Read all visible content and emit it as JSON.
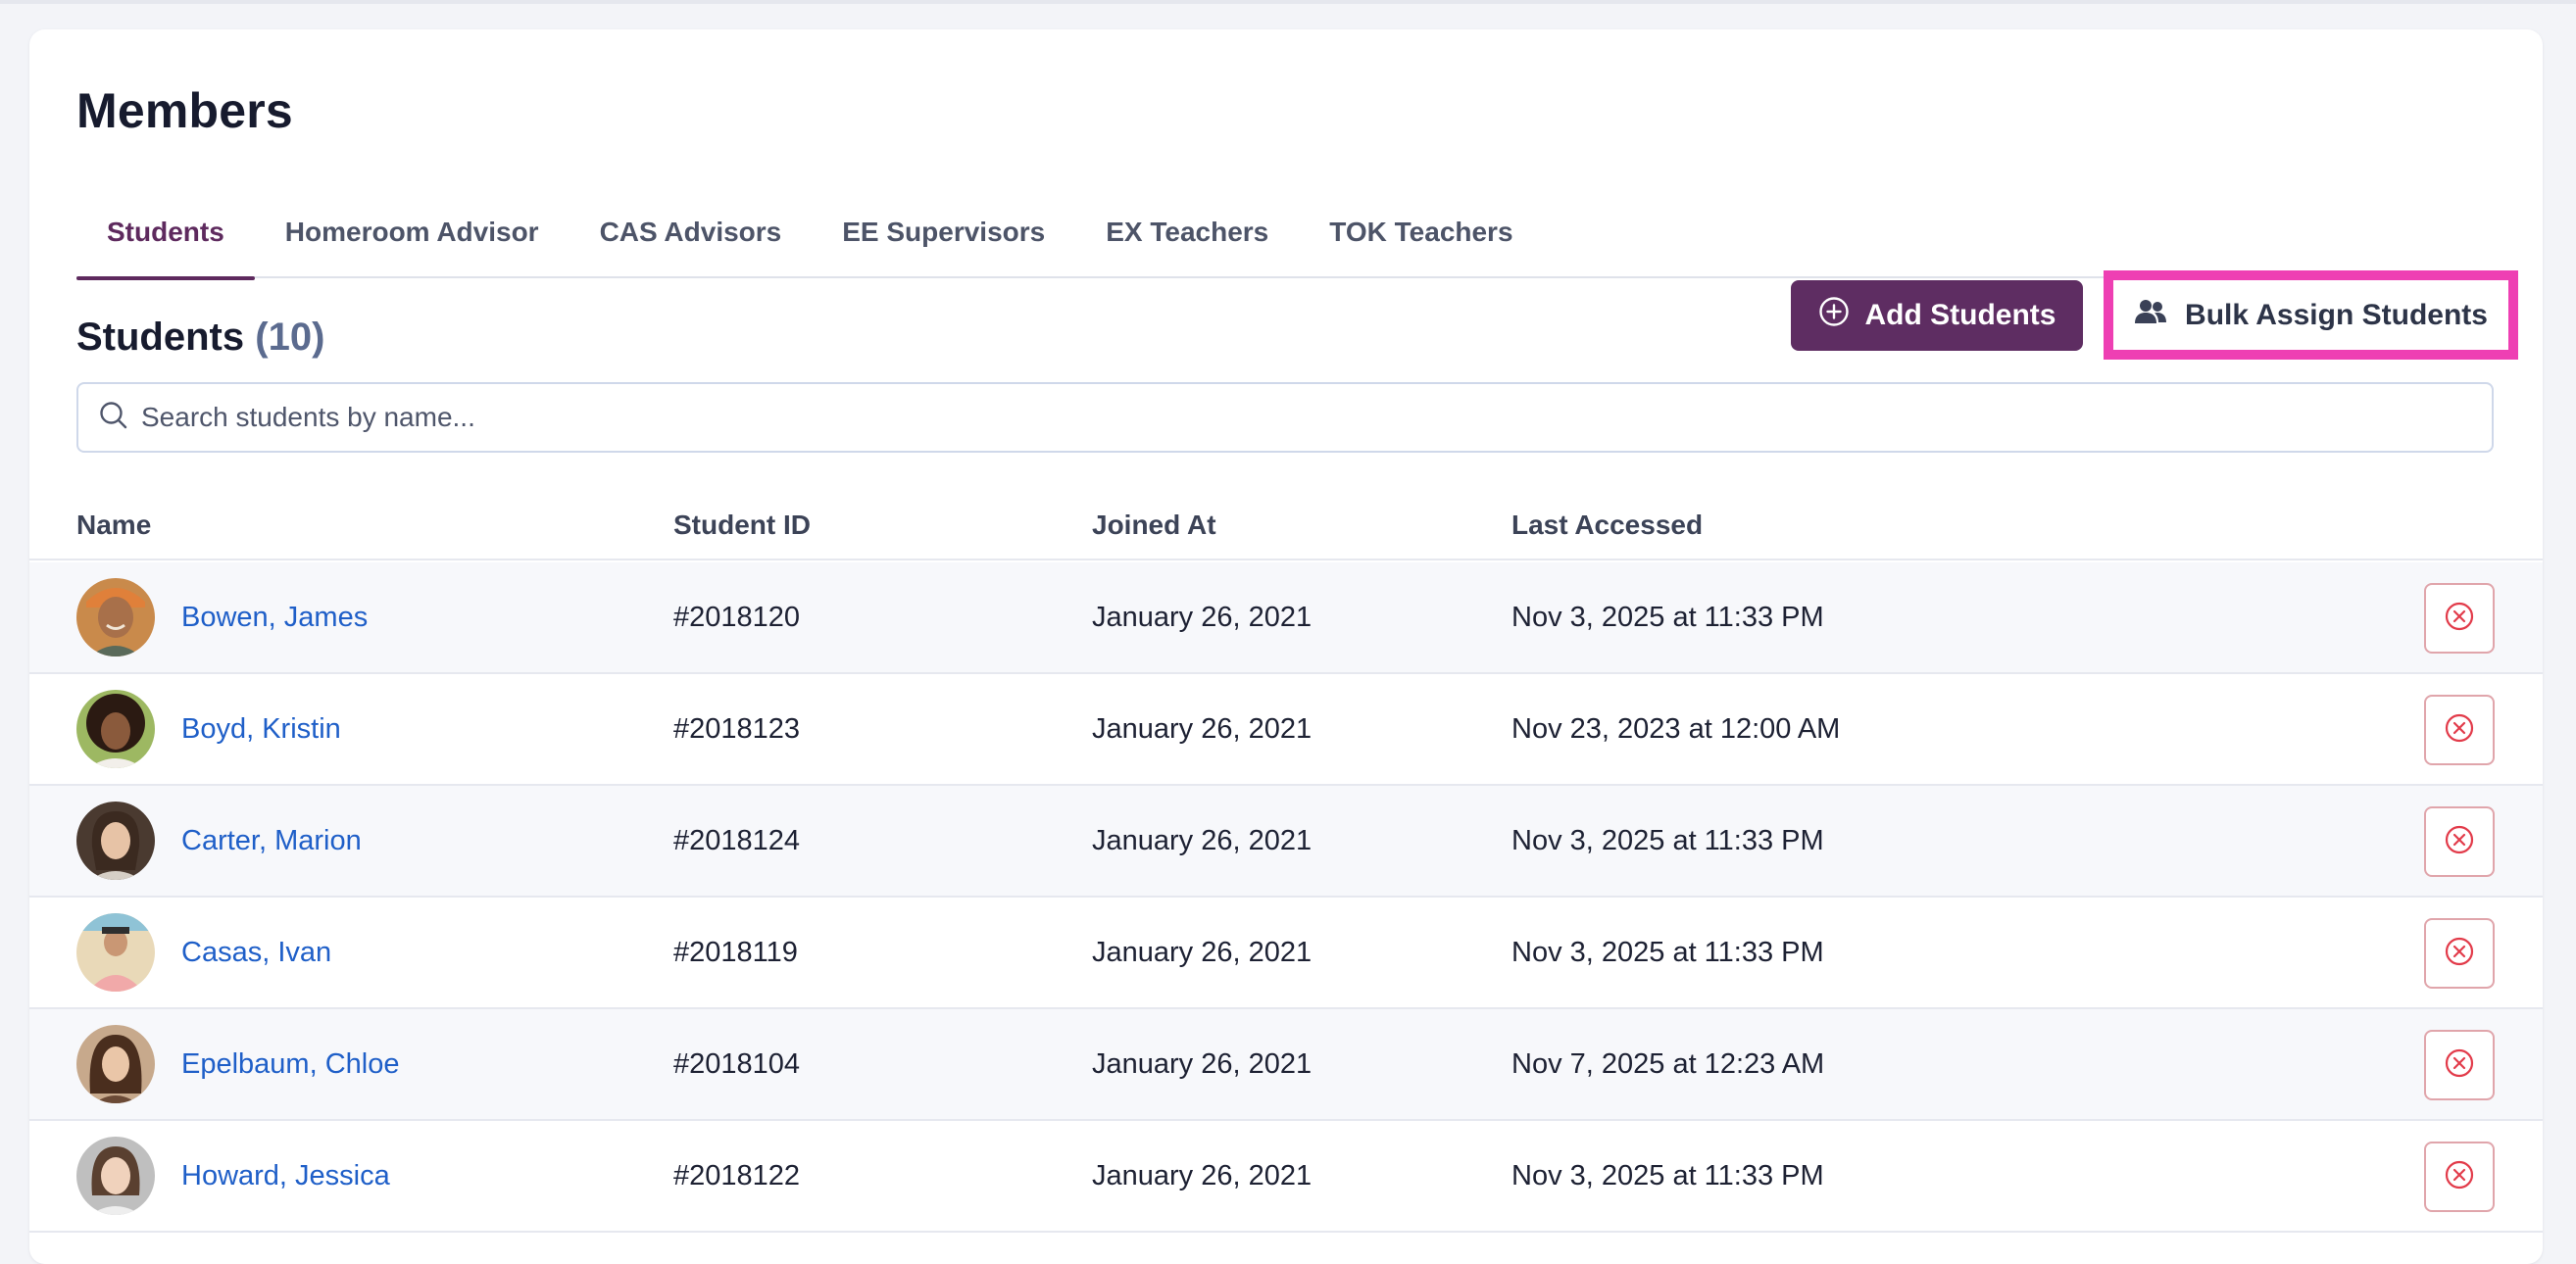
{
  "page": {
    "title": "Members"
  },
  "tabs": [
    {
      "label": "Students"
    },
    {
      "label": "Homeroom Advisor"
    },
    {
      "label": "CAS Advisors"
    },
    {
      "label": "EE Supervisors"
    },
    {
      "label": "EX Teachers"
    },
    {
      "label": "TOK Teachers"
    }
  ],
  "section": {
    "title": "Students",
    "count": "(10)"
  },
  "actions": {
    "add_label": "Add Students",
    "bulk_label": "Bulk Assign Students"
  },
  "search": {
    "placeholder": "Search students by name..."
  },
  "table": {
    "headers": {
      "name": "Name",
      "student_id": "Student ID",
      "joined_at": "Joined At",
      "last_accessed": "Last Accessed"
    },
    "rows": [
      {
        "name": "Bowen, James",
        "id": "#2018120",
        "joined": "January 26, 2021",
        "accessed": "Nov 3, 2025 at 11:33 PM"
      },
      {
        "name": "Boyd, Kristin",
        "id": "#2018123",
        "joined": "January 26, 2021",
        "accessed": "Nov 23, 2023 at 12:00 AM"
      },
      {
        "name": "Carter, Marion",
        "id": "#2018124",
        "joined": "January 26, 2021",
        "accessed": "Nov 3, 2025 at 11:33 PM"
      },
      {
        "name": "Casas, Ivan",
        "id": "#2018119",
        "joined": "January 26, 2021",
        "accessed": "Nov 3, 2025 at 11:33 PM"
      },
      {
        "name": "Epelbaum, Chloe",
        "id": "#2018104",
        "joined": "January 26, 2021",
        "accessed": "Nov 7, 2025 at 12:23 AM"
      },
      {
        "name": "Howard, Jessica",
        "id": "#2018122",
        "joined": "January 26, 2021",
        "accessed": "Nov 3, 2025 at 11:33 PM"
      }
    ]
  },
  "colors": {
    "accent": "#5e2d62",
    "link": "#1f5fc8",
    "highlight": "#ee3fb3",
    "danger": "#e23b4a"
  }
}
